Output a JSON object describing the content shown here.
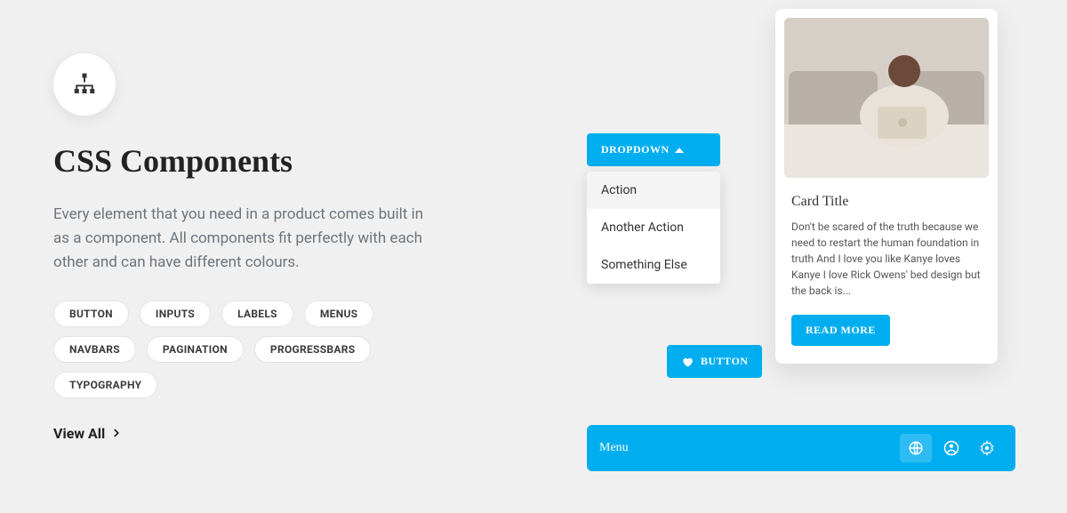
{
  "heading": "CSS Components",
  "description": "Every element that you need in a product comes built in as a component. All components fit perfectly with each other and can have different colours.",
  "chips": [
    "BUTTON",
    "INPUTS",
    "LABELS",
    "MENUS",
    "NAVBARS",
    "PAGINATION",
    "PROGRESSBARS",
    "TYPOGRAPHY"
  ],
  "viewAll": "View All",
  "dropdown": {
    "label": "DROPDOWN",
    "items": [
      "Action",
      "Another Action",
      "Something Else"
    ]
  },
  "heartButton": "BUTTON",
  "card": {
    "title": "Card Title",
    "text": "Don't be scared of the truth because we need to restart the human foundation in truth And I love you like Kanye loves Kanye I love Rick Owens' bed design but the back is...",
    "cta": "READ MORE"
  },
  "menuBar": {
    "label": "Menu"
  }
}
